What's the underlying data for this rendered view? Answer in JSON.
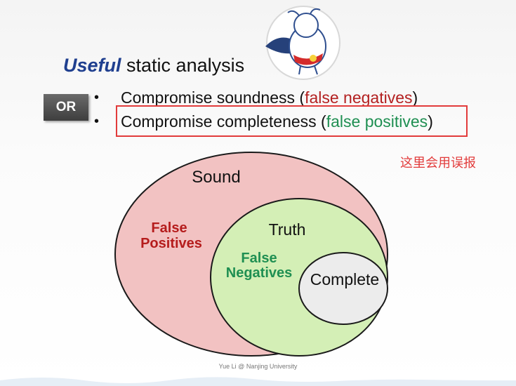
{
  "slide": {
    "title_emphasis": "Useful",
    "title_rest": " static analysis",
    "or_badge": "OR",
    "bullets": [
      {
        "marker": "•",
        "prefix": "Compromise soundness (",
        "highlight": "false negatives",
        "suffix": ")",
        "highlight_color": "#b32121"
      },
      {
        "marker": "•",
        "prefix": "Compromise completeness (",
        "highlight": "false positives",
        "suffix": ")",
        "highlight_color": "#1f8f52"
      }
    ],
    "note": "这里会用误报",
    "footer": "Yue Li @ Nanjing University"
  },
  "diagram": {
    "sound_label": "Sound",
    "false_positives_label": [
      "False",
      "Positives"
    ],
    "truth_label": "Truth",
    "false_negatives_label": [
      "False",
      "Negatives"
    ],
    "complete_label": "Complete",
    "colors": {
      "sound_fill": "#f2c2c2",
      "truth_fill": "#d4efb6",
      "complete_fill": "#ececec",
      "false_positives_text": "#b51c1c",
      "false_negatives_text": "#1f8f52",
      "highlight_box": "#e23b3b",
      "note_text": "#e23b3b",
      "title_emphasis": "#1f3f8f"
    }
  }
}
